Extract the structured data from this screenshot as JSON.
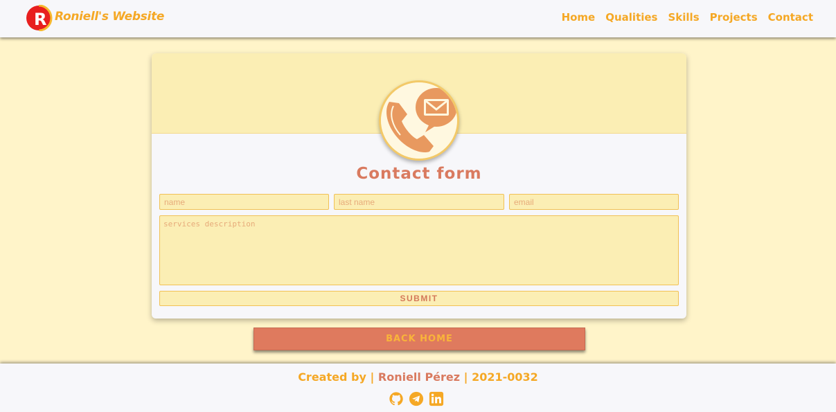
{
  "header": {
    "brand": "Roniell's Website",
    "logo_letter": "R",
    "nav": [
      "Home",
      "Qualities",
      "Skills",
      "Projects",
      "Contact"
    ]
  },
  "contact": {
    "title": "Contact form",
    "name_placeholder": "name",
    "lastname_placeholder": "last name",
    "email_placeholder": "email",
    "description_placeholder": "services description",
    "submit_label": "SUBMIT",
    "back_home_label": "BACK HOME"
  },
  "footer": {
    "created_by": "Created by |",
    "author": "Roniell Pérez",
    "id_text": "| 2021-0032",
    "socials": [
      "github-icon",
      "telegram-icon",
      "linkedin-icon"
    ]
  },
  "colors": {
    "accent": "#f5a825",
    "coral": "#df7a5e",
    "background": "#fff4c9",
    "field": "#fbeeb4"
  }
}
